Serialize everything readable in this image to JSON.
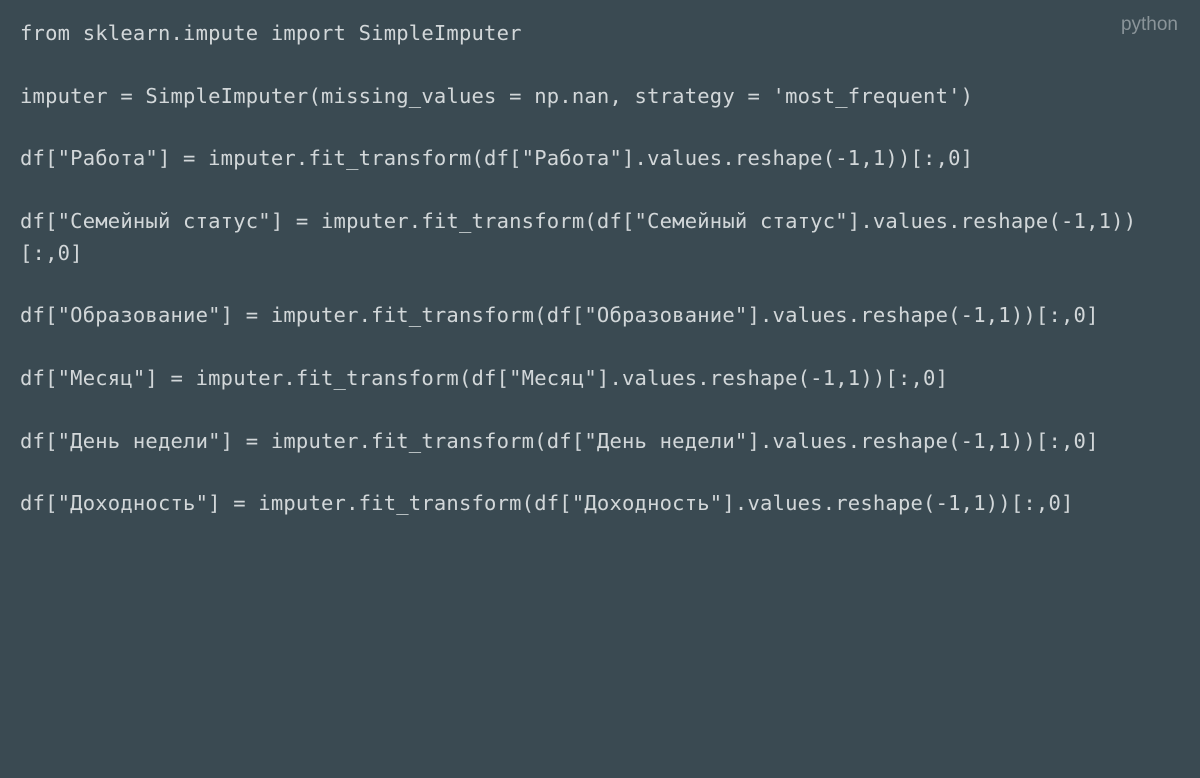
{
  "language_label": "python",
  "code": {
    "line1": "from sklearn.impute import SimpleImputer",
    "blank1": "",
    "line2": "imputer = SimpleImputer(missing_values = np.nan, strategy = 'most_frequent')",
    "blank2": "",
    "line3": "df[\"Работа\"] = imputer.fit_transform(df[\"Работа\"].values.reshape(-1,1))[:,0]",
    "blank3": "",
    "line4": "df[\"Семейный статус\"] = imputer.fit_transform(df[\"Семейный статус\"].values.reshape(-1,1))[:,0]",
    "blank4": "",
    "line5": "df[\"Образование\"] = imputer.fit_transform(df[\"Образование\"].values.reshape(-1,1))[:,0]",
    "blank5": "",
    "line6": "df[\"Месяц\"] = imputer.fit_transform(df[\"Месяц\"].values.reshape(-1,1))[:,0]",
    "blank6": "",
    "line7": "df[\"День недели\"] = imputer.fit_transform(df[\"День недели\"].values.reshape(-1,1))[:,0]",
    "blank7": "",
    "line8": "df[\"Доходность\"] = imputer.fit_transform(df[\"Доходность\"].values.reshape(-1,1))[:,0]"
  }
}
